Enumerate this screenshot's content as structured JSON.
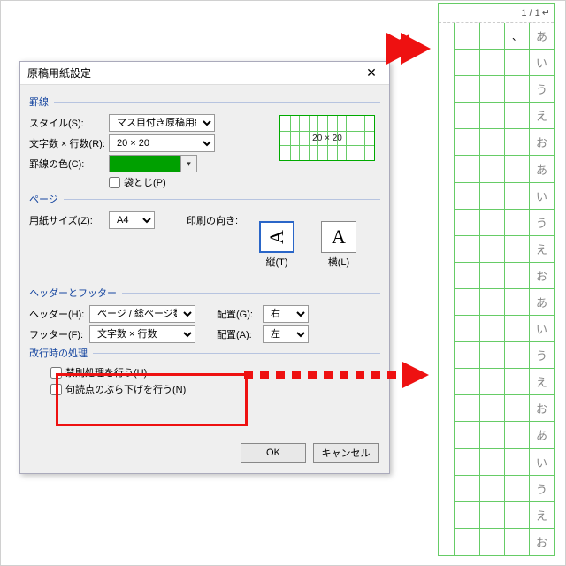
{
  "dialog": {
    "title": "原稿用紙設定",
    "groups": {
      "lines": "罫線",
      "page": "ページ",
      "hf": "ヘッダーとフッター",
      "linebreak": "改行時の処理"
    },
    "labels": {
      "style": "スタイル(S):",
      "gridsize": "文字数 × 行数(R):",
      "color": "罫線の色(C):",
      "envelope": "袋とじ(P)",
      "papersize": "用紙サイズ(Z):",
      "orient": "印刷の向き:",
      "vert": "縦(T)",
      "horz": "横(L)",
      "header": "ヘッダー(H):",
      "footer": "フッター(F):",
      "alignG": "配置(G):",
      "alignA": "配置(A):",
      "forbid": "禁則処理を行う(U)",
      "hanging": "句読点のぶら下げを行う(N)"
    },
    "values": {
      "style": "マス目付き原稿用紙",
      "gridsize": "20 × 20",
      "papersize": "A4",
      "header": "ページ / 総ページ数",
      "footer": "文字数 × 行数",
      "alignG": "右",
      "alignA": "左"
    },
    "preview": {
      "text": "20 × 20"
    },
    "color_hex": "#00a000",
    "buttons": {
      "ok": "OK",
      "cancel": "キャンセル"
    }
  },
  "sheet": {
    "page_indicator": "1 / 1",
    "column_chars": [
      "あ",
      "い",
      "う",
      "え",
      "お",
      "あ",
      "い",
      "う",
      "え",
      "お",
      "あ",
      "い",
      "う",
      "え",
      "お",
      "あ",
      "い",
      "う",
      "え",
      "お"
    ],
    "col2_top": "、"
  }
}
